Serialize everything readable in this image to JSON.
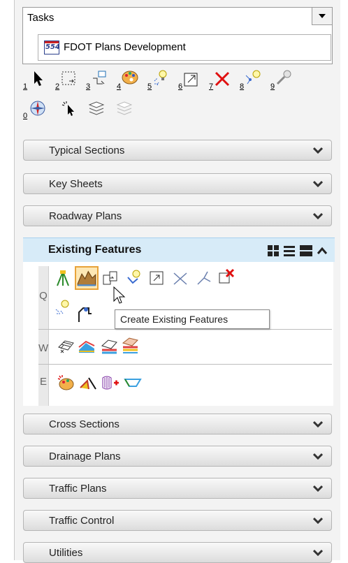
{
  "tasks": {
    "label": "Tasks",
    "subtitle": "FDOT Plans Development",
    "logo_text": "554"
  },
  "toolbar": {
    "numbers": [
      "1",
      "2",
      "3",
      "4",
      "5",
      "6",
      "7",
      "8",
      "9",
      "0"
    ]
  },
  "sections_top": [
    {
      "label": "Typical Sections"
    },
    {
      "label": "Key Sheets"
    },
    {
      "label": "Roadway Plans"
    }
  ],
  "expanded": {
    "label": "Existing Features",
    "rows": [
      "Q",
      "W",
      "E"
    ],
    "tooltip": "Create Existing Features"
  },
  "sections_bottom": [
    {
      "label": "Cross Sections"
    },
    {
      "label": "Drainage Plans"
    },
    {
      "label": "Traffic Plans"
    },
    {
      "label": "Traffic Control"
    },
    {
      "label": "Utilities"
    }
  ],
  "colors": {
    "expanded_bg": "#d7ebf8",
    "selected_tool_border": "#e8a33a"
  }
}
